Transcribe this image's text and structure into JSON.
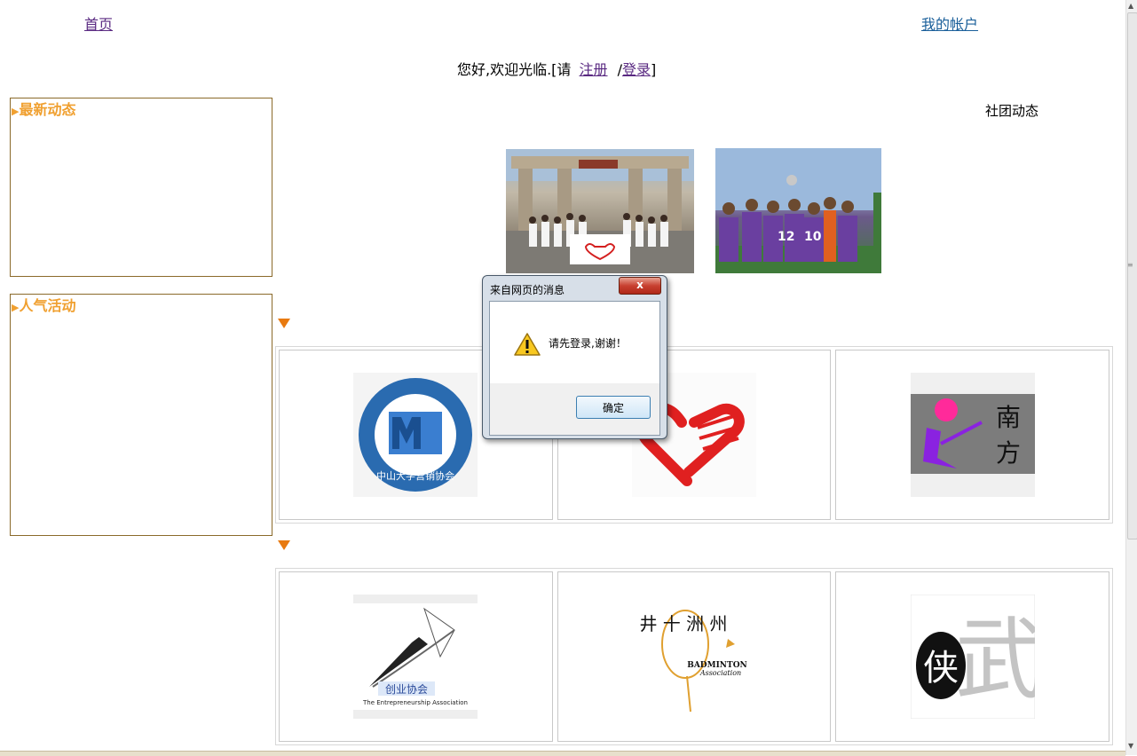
{
  "nav": {
    "home": "首页",
    "account": "我的帐户"
  },
  "welcome": {
    "prefix": "您好,欢迎光临.[请",
    "register": "注册",
    "slash": "/",
    "login": "登录",
    "suffix": "]"
  },
  "sidebar": {
    "latest_title": "最新动态",
    "popular_title": "人气活动",
    "title_marker": "▶"
  },
  "club_news_label": "社团动态",
  "dialog": {
    "title": "来自网页的消息",
    "close": "x",
    "message": "请先登录,谢谢！",
    "ok": "确定"
  },
  "colors": {
    "accent_orange": "#f0a030",
    "arrow_orange": "#e87a10",
    "link": "#5a2a82"
  },
  "logos": {
    "marketing": "Marketing Association Sun Yat-Sen University",
    "marketing_cn": "中山大学营销协会",
    "volunteer": "heart-hand-logo",
    "south_cn": [
      "南",
      "方"
    ],
    "entrepreneur_cn": "创业协会",
    "entrepreneur_en": "The Entrepreneurship Association",
    "badminton_en": "BADMINTON",
    "badminton_sub": "Association",
    "badminton_cn": "井 十 洲 州",
    "wushu_cn": [
      "侠",
      "武"
    ]
  }
}
